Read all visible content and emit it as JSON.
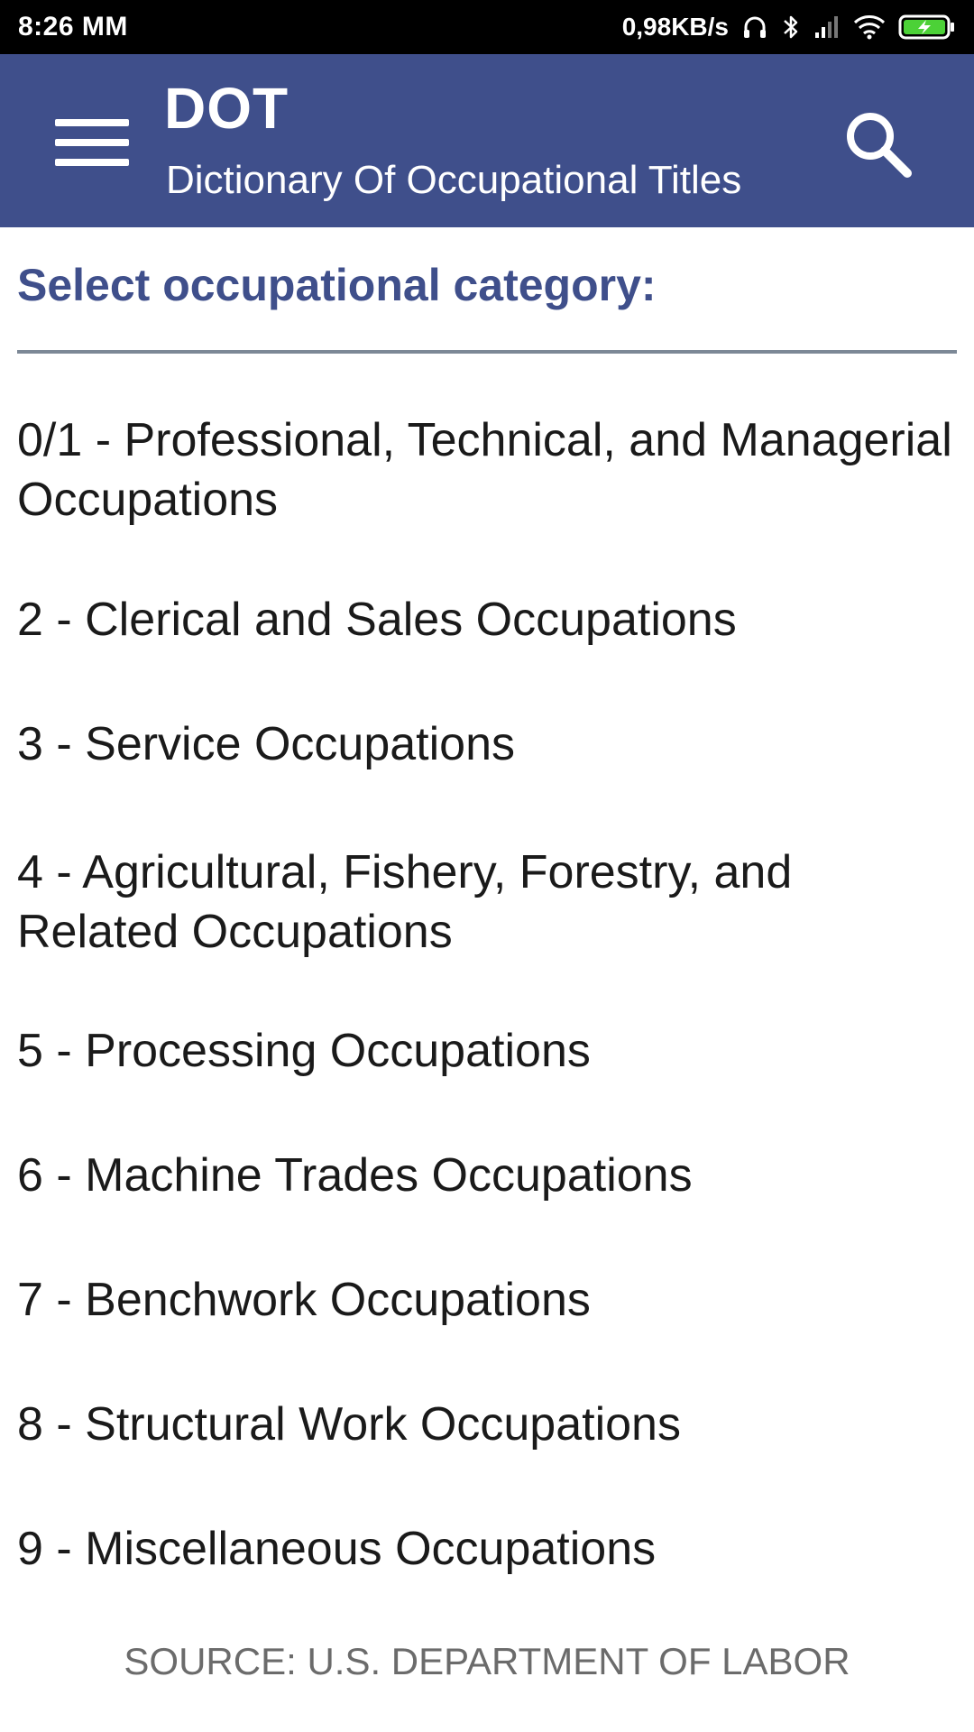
{
  "status_bar": {
    "time": "8:26 MM",
    "network_speed": "0,98KB/s",
    "icons": [
      "headphones-icon",
      "bluetooth-icon",
      "signal-icon",
      "wifi-icon",
      "battery-charging-icon"
    ]
  },
  "app_bar": {
    "title": "DOT",
    "subtitle": "Dictionary Of Occupational Titles",
    "menu_icon": "hamburger-menu-icon",
    "search_icon": "search-icon"
  },
  "content": {
    "heading": "Select occupational category:",
    "categories": [
      {
        "label": "0/1 - Professional, Technical, and Managerial Occupations"
      },
      {
        "label": "2 - Clerical and Sales Occupations"
      },
      {
        "label": "3 - Service Occupations"
      },
      {
        "label": "4 - Agricultural, Fishery, Forestry, and Related Occupations"
      },
      {
        "label": "5 - Processing Occupations"
      },
      {
        "label": "6 - Machine Trades Occupations"
      },
      {
        "label": "7 - Benchwork Occupations"
      },
      {
        "label": "8 - Structural Work Occupations"
      },
      {
        "label": "9 - Miscellaneous Occupations"
      }
    ],
    "source": "SOURCE: U.S. DEPARTMENT OF LABOR"
  },
  "colors": {
    "app_bar": "#3f4f8b",
    "heading": "#3f4f8b",
    "divider": "#7c8896",
    "battery_fill": "#4cd137"
  }
}
